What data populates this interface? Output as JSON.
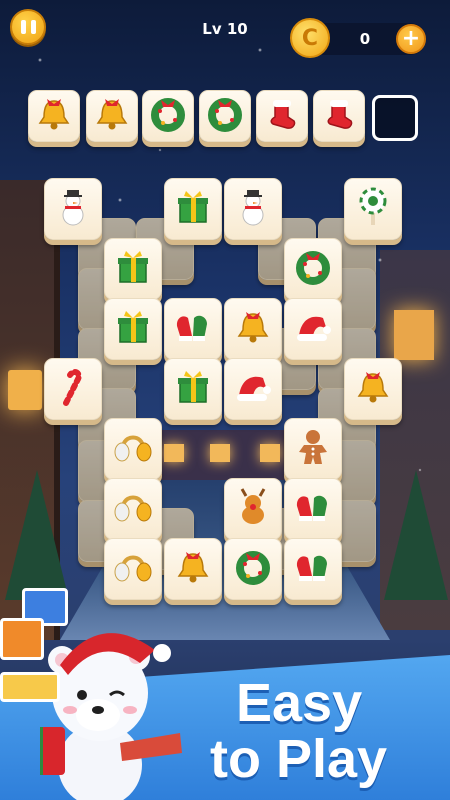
{
  "top_bar": {
    "pause_icon": "pause-icon",
    "level_label": "Lv 10",
    "coin_symbol": "C",
    "coins": "0",
    "add_symbol": "+"
  },
  "tray": {
    "slots": [
      "bell",
      "bell",
      "wreath",
      "wreath",
      "stocking",
      "stocking",
      "empty"
    ]
  },
  "board": {
    "top_layer_tiles": [
      {
        "row": 1,
        "col": 1,
        "icon": "snowman"
      },
      {
        "row": 1,
        "col": 3,
        "icon": "green-gift"
      },
      {
        "row": 1,
        "col": 4,
        "icon": "snowman"
      },
      {
        "row": 1,
        "col": 6,
        "icon": "lollipop"
      },
      {
        "row": 2,
        "col": 2,
        "icon": "green-gift"
      },
      {
        "row": 2,
        "col": 5,
        "icon": "wreath"
      },
      {
        "row": 3,
        "col": 2,
        "icon": "green-gift"
      },
      {
        "row": 3,
        "col": 3,
        "icon": "mittens"
      },
      {
        "row": 3,
        "col": 4,
        "icon": "bell"
      },
      {
        "row": 3,
        "col": 5,
        "icon": "santa-hat"
      },
      {
        "row": 4,
        "col": 1,
        "icon": "candy-cane"
      },
      {
        "row": 4,
        "col": 3,
        "icon": "green-gift"
      },
      {
        "row": 4,
        "col": 4,
        "icon": "santa-hat"
      },
      {
        "row": 4,
        "col": 6,
        "icon": "bell"
      },
      {
        "row": 5,
        "col": 2,
        "icon": "earmuffs"
      },
      {
        "row": 5,
        "col": 5,
        "icon": "gingerbread"
      },
      {
        "row": 6,
        "col": 2,
        "icon": "earmuffs"
      },
      {
        "row": 6,
        "col": 4,
        "icon": "reindeer"
      },
      {
        "row": 6,
        "col": 5,
        "icon": "mittens"
      },
      {
        "row": 7,
        "col": 2,
        "icon": "earmuffs"
      },
      {
        "row": 7,
        "col": 3,
        "icon": "bell"
      },
      {
        "row": 7,
        "col": 4,
        "icon": "wreath"
      },
      {
        "row": 7,
        "col": 5,
        "icon": "mittens"
      }
    ]
  },
  "promo": {
    "line1": "Easy",
    "line2": "to Play",
    "mascot": "polar-bear-icon"
  },
  "colors": {
    "banner": "#3d90e4",
    "coin": "#f1a615",
    "tile_face": "#fffaf0"
  }
}
